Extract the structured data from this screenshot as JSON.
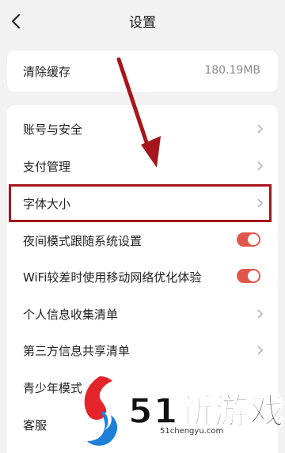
{
  "header": {
    "title": "设置"
  },
  "cache": {
    "label": "清除缓存",
    "size": "180.19MB"
  },
  "menu": [
    {
      "label": "账号与安全",
      "control": "chevron"
    },
    {
      "label": "支付管理",
      "control": "chevron"
    },
    {
      "label": "字体大小",
      "control": "chevron",
      "highlighted": true
    },
    {
      "label": "夜间模式跟随系统设置",
      "control": "toggle",
      "on": true
    },
    {
      "label": "WiFi较差时使用移动网络优化体验",
      "control": "toggle",
      "on": true
    },
    {
      "label": "个人信息收集清单",
      "control": "chevron"
    },
    {
      "label": "第三方信息共享清单",
      "control": "chevron"
    },
    {
      "label": "青少年模式",
      "control": "chevron"
    },
    {
      "label": "客服",
      "control": "chevron"
    }
  ],
  "watermark": {
    "brand": "51新游戏",
    "domain": "51chengyu.com"
  },
  "colors": {
    "accent": "#e2574c",
    "annotation": "#a5161d",
    "background": "#f2f2f2",
    "card": "#ffffff"
  },
  "icons": [
    "back-arrow-icon",
    "chevron-right-icon",
    "toggle-switch",
    "annotation-arrow",
    "watermark-logo"
  ]
}
